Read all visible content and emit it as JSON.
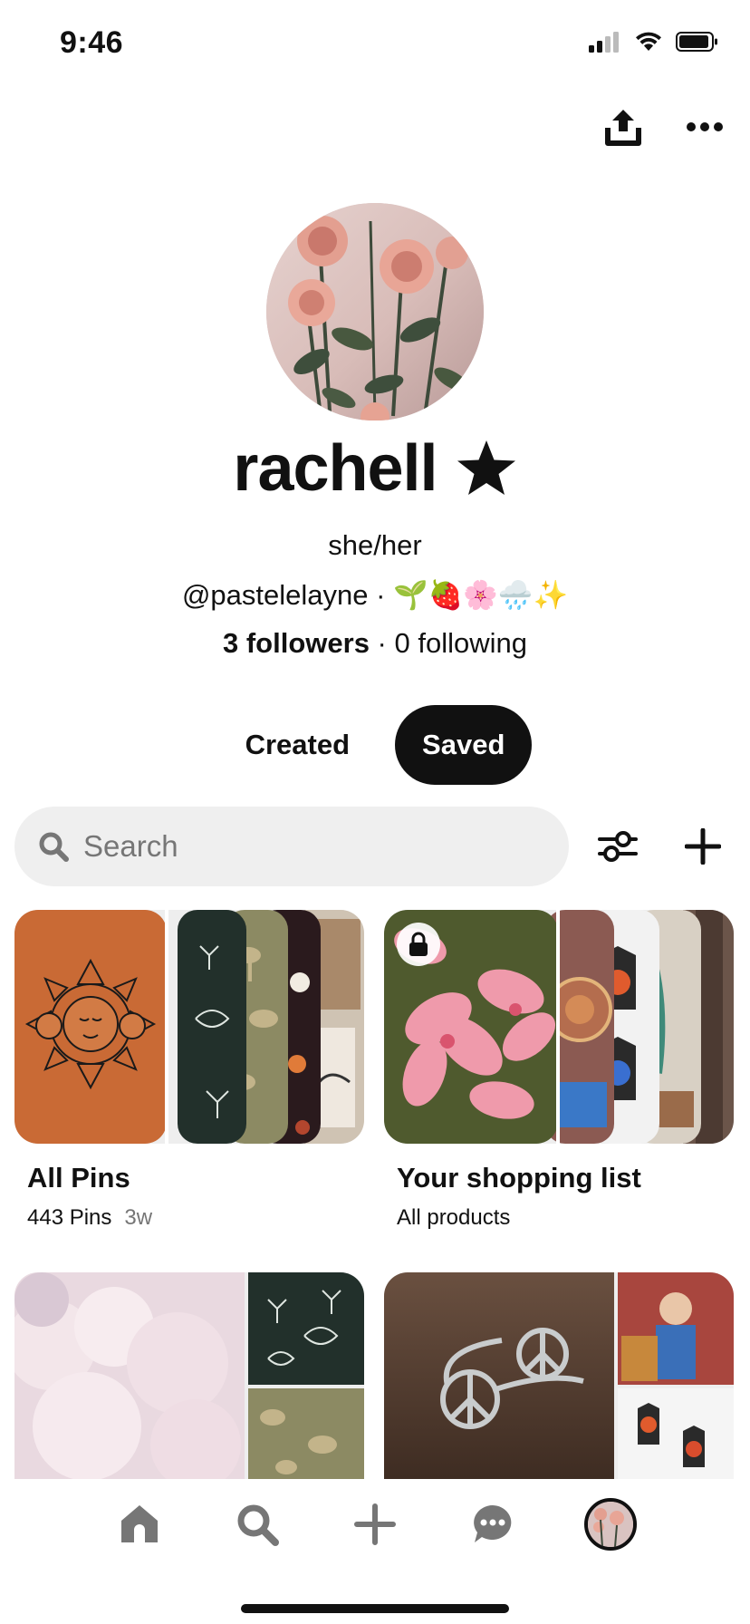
{
  "status_bar": {
    "time": "9:46"
  },
  "profile": {
    "name": "rachell",
    "pronouns": "she/her",
    "handle_line": "@pastelelayne · 🌱🍓🌸🌧️✨",
    "followers": "3 followers",
    "separator": " · ",
    "following": "0 following"
  },
  "tabs": {
    "created": "Created",
    "saved": "Saved",
    "active": "Saved"
  },
  "search": {
    "placeholder": "Search",
    "value": ""
  },
  "boards": [
    {
      "title": "All Pins",
      "subtitle": "443 Pins",
      "age": "3w"
    },
    {
      "title": "Your shopping list",
      "subtitle": "All products",
      "private": true
    }
  ],
  "icons": {
    "share": "share-icon",
    "more": "more-icon",
    "filter": "filter-icon",
    "add": "plus-icon",
    "lock": "lock-icon",
    "nav_home": "home-icon",
    "nav_search": "search-icon",
    "nav_create": "plus-icon",
    "nav_messages": "chat-icon"
  },
  "colors": {
    "accent": "#111111",
    "search_bg": "#efefef",
    "orange_cover": "#c96a35",
    "nav_icon": "#767676"
  }
}
